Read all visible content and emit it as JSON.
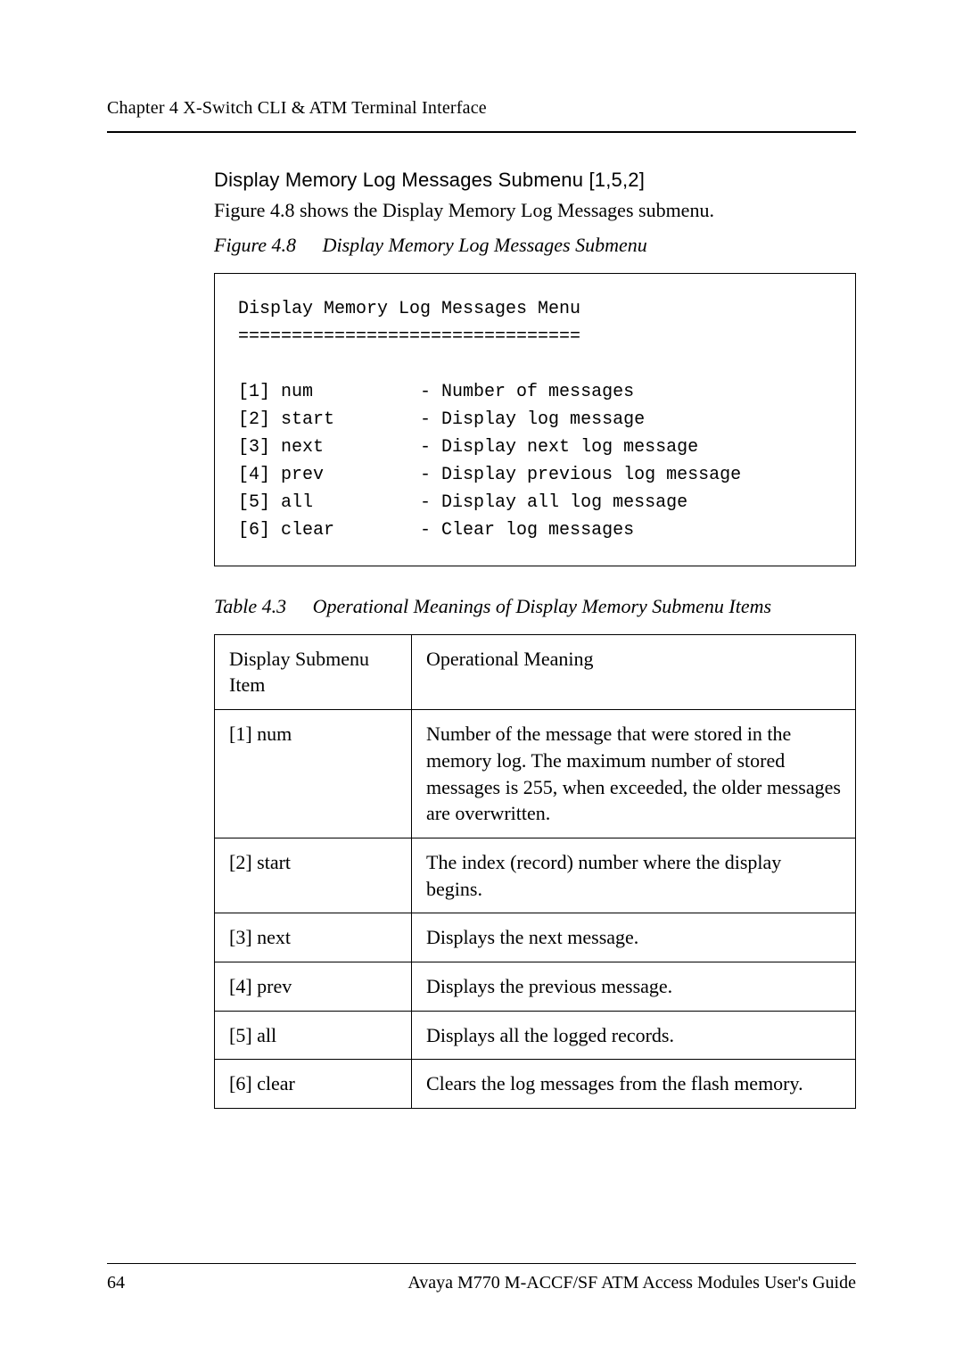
{
  "running_head": "Chapter 4     X-Switch CLI & ATM Terminal Interface",
  "subhead": "Display Memory Log Messages Submenu [1,5,2]",
  "intro": "Figure 4.8 shows the Display Memory Log Messages submenu.",
  "figure_caption_label": "Figure 4.8",
  "figure_caption_title": "Display Memory Log Messages Submenu",
  "codebox": "Display Memory Log Messages Menu\n================================\n\n[1] num          - Number of messages\n[2] start        - Display log message\n[3] next         - Display next log message\n[4] prev         - Display previous log message\n[5] all          - Display all log message\n[6] clear        - Clear log messages",
  "table_caption_label": "Table 4.3",
  "table_caption_title": "Operational Meanings of Display Memory Submenu Items",
  "table": {
    "header_left": "Display Submenu Item",
    "header_right": "Operational Meaning",
    "rows": [
      {
        "key": "[1] num",
        "val": "Number of the message that were stored in the memory log. The maximum number of stored messages is 255, when exceeded, the older messages are overwritten."
      },
      {
        "key": "[2] start",
        "val": "The index (record) number where the display begins."
      },
      {
        "key": "[3] next",
        "val": "Displays the next message."
      },
      {
        "key": "[4] prev",
        "val": "Displays the previous message."
      },
      {
        "key": "[5] all",
        "val": "Displays all the logged records."
      },
      {
        "key": "[6] clear",
        "val": "Clears the log messages from the flash memory."
      }
    ]
  },
  "footer_page": "64",
  "footer_title": "Avaya M770 M-ACCF/SF ATM Access Modules User's Guide"
}
